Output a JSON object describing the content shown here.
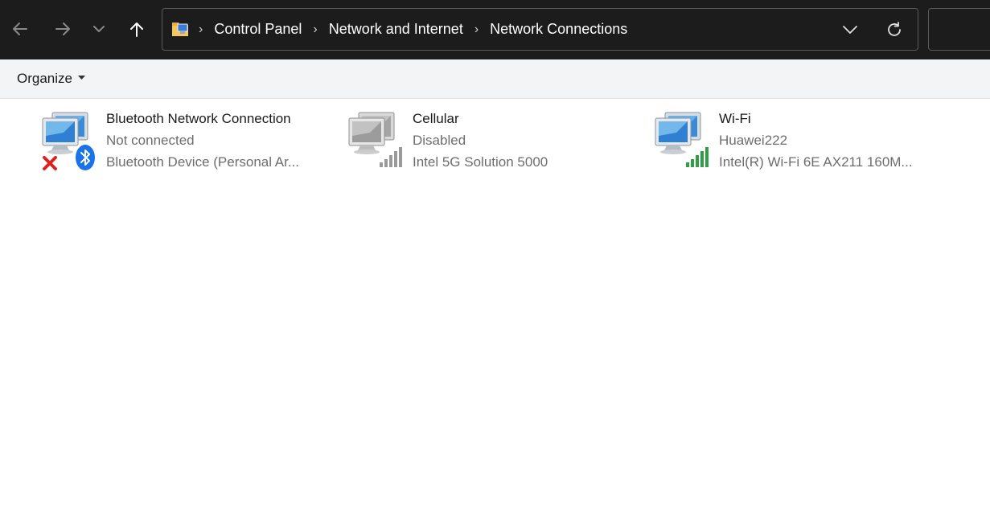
{
  "address_bar": {
    "breadcrumbs": [
      {
        "label": "Control Panel"
      },
      {
        "label": "Network and Internet"
      },
      {
        "label": "Network Connections"
      }
    ]
  },
  "command_bar": {
    "organize_label": "Organize"
  },
  "connections": [
    {
      "name": "Bluetooth Network Connection",
      "status": "Not connected",
      "device": "Bluetooth Device (Personal Ar...",
      "icon": "bluetooth-network-icon"
    },
    {
      "name": "Cellular",
      "status": "Disabled",
      "device": "Intel 5G Solution 5000",
      "icon": "cellular-network-icon"
    },
    {
      "name": "Wi-Fi",
      "status": "Huawei222",
      "device": "Intel(R) Wi-Fi 6E AX211 160M...",
      "icon": "wifi-network-icon"
    }
  ],
  "colors": {
    "titlebar": "#1c1c1c",
    "command_bar": "#f3f4f6",
    "signal_green": "#2f9e44",
    "bluetooth_blue": "#1a73e8",
    "error_red": "#e02020"
  }
}
